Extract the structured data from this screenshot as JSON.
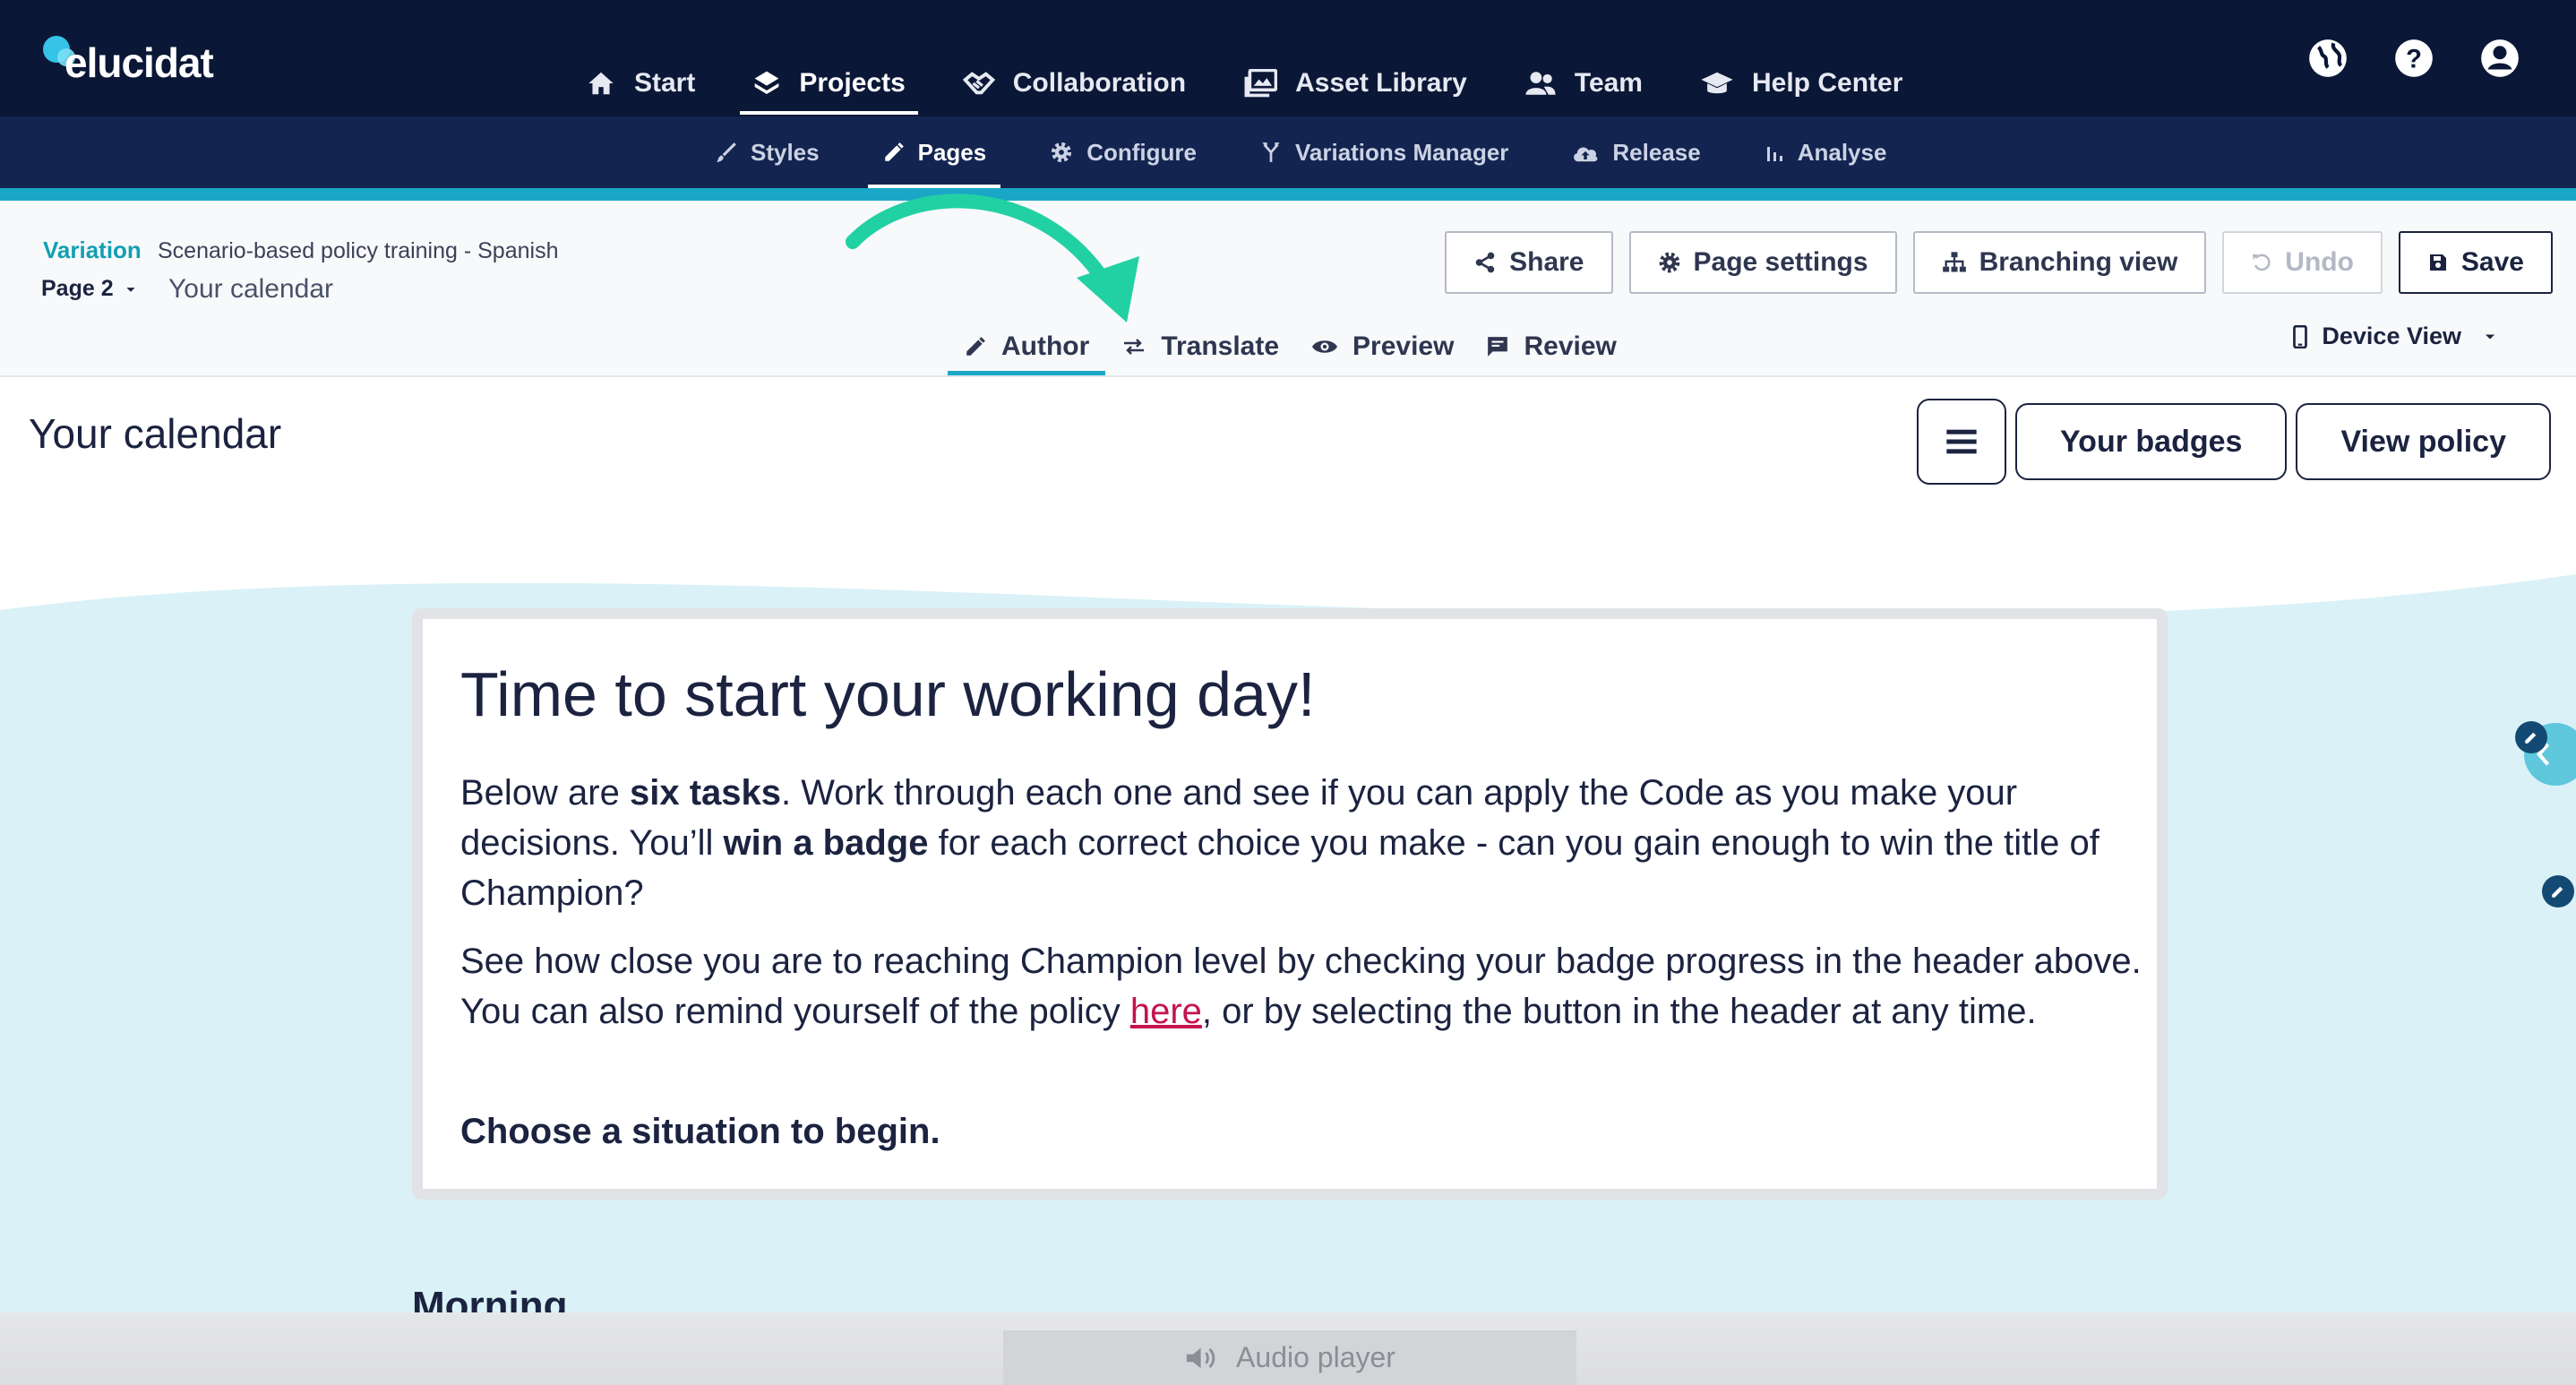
{
  "brand": {
    "name": "elucidat"
  },
  "colors": {
    "topbar": "#0b1736",
    "subbar": "#132450",
    "accent": "#1aa7c7",
    "link": "#c4134f",
    "content_bg": "#daf2f7",
    "annotation_arrow": "#22d1a3"
  },
  "main_nav": [
    {
      "label": "Start",
      "icon": "home-icon"
    },
    {
      "label": "Projects",
      "icon": "layers-icon",
      "active": true
    },
    {
      "label": "Collaboration",
      "icon": "handshake-icon"
    },
    {
      "label": "Asset Library",
      "icon": "images-icon"
    },
    {
      "label": "Team",
      "icon": "users-icon"
    },
    {
      "label": "Help Center",
      "icon": "graduation-cap-icon"
    }
  ],
  "top_icons": [
    "globe-icon",
    "help-icon",
    "account-icon"
  ],
  "sub_nav": [
    {
      "label": "Styles",
      "icon": "brush-icon"
    },
    {
      "label": "Pages",
      "icon": "pencil-icon",
      "active": true
    },
    {
      "label": "Configure",
      "icon": "gear-icon"
    },
    {
      "label": "Variations Manager",
      "icon": "fork-icon"
    },
    {
      "label": "Release",
      "icon": "cloud-upload-icon"
    },
    {
      "label": "Analyse",
      "icon": "bar-chart-icon"
    }
  ],
  "page_header": {
    "variation_label": "Variation",
    "variation_name": "Scenario-based policy training - Spanish",
    "page_selector": "Page 2",
    "page_title": "Your calendar",
    "buttons": {
      "share": "Share",
      "page_settings": "Page settings",
      "branching_view": "Branching view",
      "undo": "Undo",
      "save": "Save"
    },
    "modes": {
      "author": "Author",
      "translate": "Translate",
      "preview": "Preview",
      "review": "Review"
    },
    "active_mode": "Author",
    "device_view": "Device View"
  },
  "content": {
    "title": "Your calendar",
    "buttons": {
      "badges": "Your badges",
      "policy": "View policy"
    },
    "card": {
      "heading": "Time to start your working day!",
      "p1": {
        "a": "Below are ",
        "b": "six tasks",
        "c": ". Work through each one and see if you can apply the Code as you make your decisions. You’ll ",
        "d": "win a badge",
        "e": " for each correct choice you make - can you gain enough to win the title of Champion?"
      },
      "p2": {
        "a": "See how close you are to reaching Champion level by checking your badge progress in the header above. You can also remind yourself of the policy ",
        "link": "here",
        "b": ", or by selecting the button in the header at any time."
      },
      "p3": "Choose a situation to begin."
    },
    "section_heading": "Morning"
  },
  "audio_player": {
    "label": "Audio player"
  }
}
